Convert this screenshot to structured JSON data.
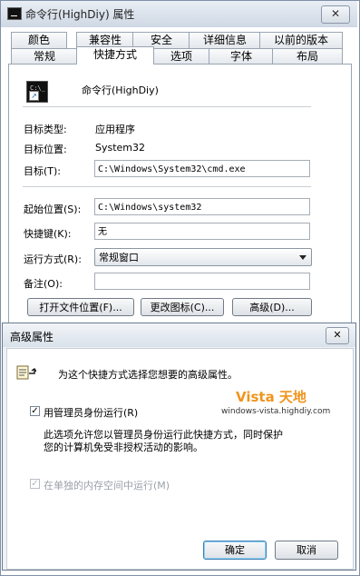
{
  "window": {
    "title": "命令行(HighDiy) 属性",
    "close_glyph": "✕"
  },
  "tabs_top": [
    {
      "label": "颜色"
    },
    {
      "label": "兼容性"
    },
    {
      "label": "安全"
    },
    {
      "label": "详细信息"
    },
    {
      "label": "以前的版本"
    }
  ],
  "tabs_bottom": [
    {
      "label": "常规"
    },
    {
      "label": "快捷方式",
      "active": true
    },
    {
      "label": "选项"
    },
    {
      "label": "字体"
    },
    {
      "label": "布局"
    }
  ],
  "shortcut": {
    "name": "命令行(HighDiy)",
    "icon_prompt": "C:\\_",
    "target_type_label": "目标类型:",
    "target_type_value": "应用程序",
    "target_location_label": "目标位置:",
    "target_location_value": "System32",
    "target_label": "目标(T):",
    "target_value": "C:\\Windows\\System32\\cmd.exe",
    "start_in_label": "起始位置(S):",
    "start_in_value": "C:\\Windows\\system32",
    "hotkey_label": "快捷键(K):",
    "hotkey_value": "无",
    "run_label": "运行方式(R):",
    "run_value": "常规窗口",
    "comment_label": "备注(O):",
    "comment_value": "",
    "open_location_button": "打开文件位置(F)...",
    "change_icon_button": "更改图标(C)...",
    "advanced_button": "高级(D)..."
  },
  "advanced_dialog": {
    "title": "高级属性",
    "close_glyph": "✕",
    "intro": "为这个快捷方式选择您想要的高级属性。",
    "run_as_admin_label": "用管理员身份运行(R)",
    "run_as_admin_checked": true,
    "description_line1": "此选项允许您以管理员身份运行此快捷方式，同时保护",
    "description_line2": "您的计算机免受非授权活动的影响。",
    "separate_memory_label": "在单独的内存空间中运行(M)",
    "separate_memory_checked": true,
    "separate_memory_disabled": true,
    "ok_button": "确定",
    "cancel_button": "取消"
  },
  "watermark": {
    "brand": "Vista 天地",
    "url": "windows-vista.highdiy.com"
  },
  "colors": {
    "watermark_orange": "#f0941e",
    "default_button_border": "#3c7fb1"
  },
  "icons": [
    "console-app-icon",
    "shortcut-arrow-icon",
    "advanced-properties-icon",
    "checkbox-checked-icon",
    "dropdown-arrow-icon",
    "close-icon"
  ]
}
